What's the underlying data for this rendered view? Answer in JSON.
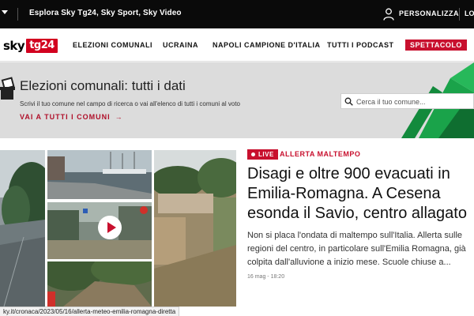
{
  "topbar": {
    "explore": "Esplora Sky Tg24, Sky Sport, Sky Video",
    "personalize": "PERSONALIZZA",
    "login": "LO"
  },
  "logo": {
    "sky": "sky",
    "tg": "tg24"
  },
  "nav": {
    "items": [
      "ELEZIONI COMUNALI",
      "UCRAINA",
      "NAPOLI CAMPIONE D'ITALIA",
      "TUTTI I PODCAST"
    ],
    "badge": "SPETTACOLO"
  },
  "banner": {
    "title": "Elezioni comunali: tutti i dati",
    "subtitle": "Scrivi il tuo comune nel campo di ricerca o vai all'elenco di tutti i comuni al voto",
    "link": "VAI A TUTTI I COMUNI",
    "search_placeholder": "Cerca il tuo comune..."
  },
  "story": {
    "live": "LIVE",
    "kicker": "ALLERTA MALTEMPO",
    "headline": [
      "Disagi e oltre 900 evacuati in",
      "Emilia-Romagna. A Cesena",
      "esonda il Savio, centro allagato"
    ],
    "summary": "Non si placa l'ondata di maltempo sull'Italia. Allerta sulle regioni del centro, in particolare sull'Emilia Romagna, già colpita dall'alluvione a inizio mese. Scuole chiuse a...",
    "timestamp": "16 mag - 18:20"
  },
  "statusbar": {
    "url": "ky.it/cronaca/2023/05/16/allerta-meteo-emilia-romagna-diretta"
  },
  "colors": {
    "brand_red": "#c8102e",
    "accent_green": "#1aa34a",
    "topbar": "#0a0a0a"
  }
}
